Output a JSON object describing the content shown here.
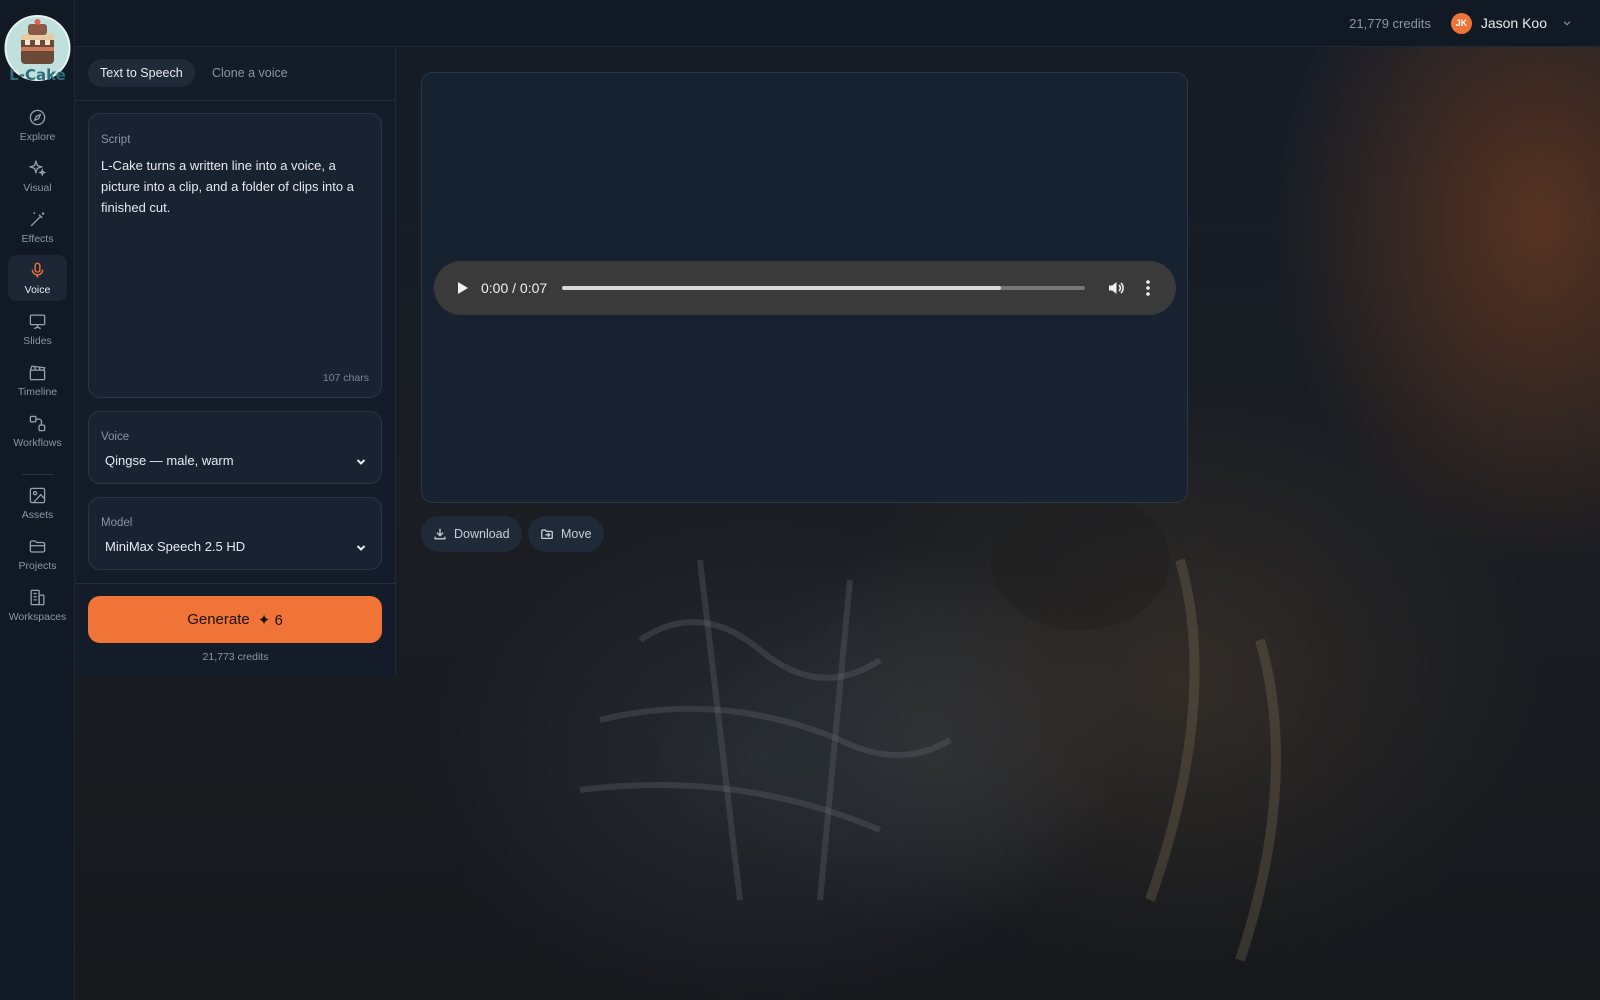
{
  "app": {
    "logo_text": "L-Cake"
  },
  "topbar": {
    "credits": "21,779 credits",
    "user_initials": "JK",
    "user_name": "Jason Koo"
  },
  "sidebar": {
    "items": [
      {
        "label": "Explore",
        "icon": "compass-icon"
      },
      {
        "label": "Visual",
        "icon": "sparkles-icon"
      },
      {
        "label": "Effects",
        "icon": "magic-wand-icon"
      },
      {
        "label": "Voice",
        "icon": "microphone-icon",
        "active": true
      },
      {
        "label": "Slides",
        "icon": "presentation-icon"
      },
      {
        "label": "Timeline",
        "icon": "clapperboard-icon"
      },
      {
        "label": "Workflows",
        "icon": "workflow-icon"
      },
      {
        "label": "Assets",
        "icon": "images-icon"
      },
      {
        "label": "Projects",
        "icon": "folder-icon"
      },
      {
        "label": "Workspaces",
        "icon": "buildings-icon"
      }
    ]
  },
  "tabs": {
    "tts": "Text to Speech",
    "clone": "Clone a voice"
  },
  "script": {
    "label": "Script",
    "text": "L-Cake turns a written line into a voice, a picture into a clip, and a folder of clips into a finished cut.",
    "char_count": "107 chars"
  },
  "voice": {
    "label": "Voice",
    "value": "Qingse — male, warm"
  },
  "model": {
    "label": "Model",
    "value": "MiniMax Speech 2.5 HD"
  },
  "generate": {
    "label": "Generate",
    "cost": "✦ 6",
    "credits": "21,773 credits"
  },
  "player": {
    "time": "0:00 / 0:07",
    "progress_percent": 84
  },
  "actions": {
    "download": "Download",
    "move": "Move"
  },
  "colors": {
    "accent": "#f07337",
    "panel": "#131c28",
    "card": "#182231"
  }
}
